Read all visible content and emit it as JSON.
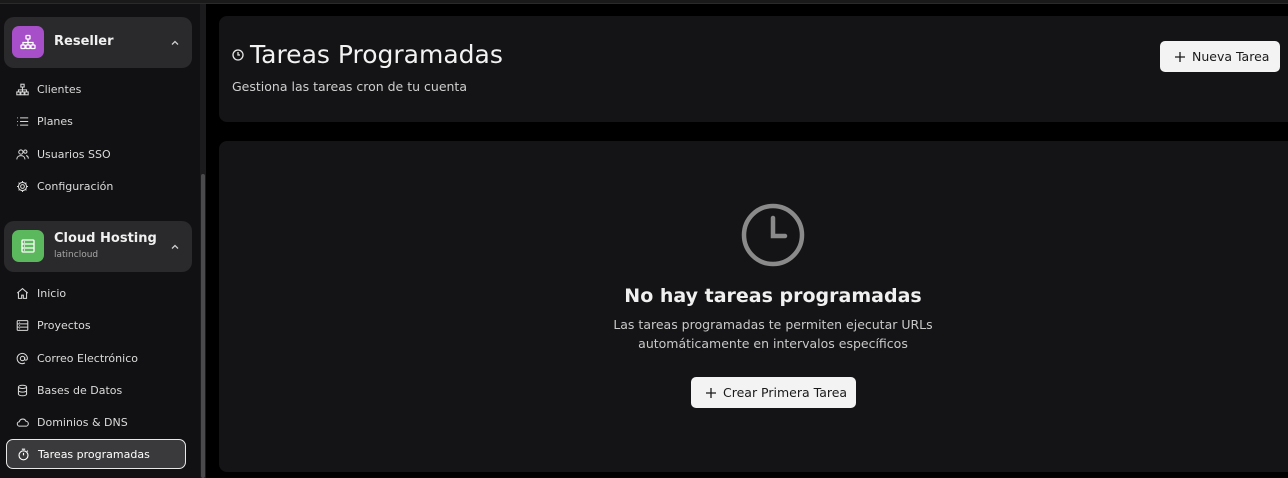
{
  "sidebar": {
    "reseller": {
      "title": "Reseller",
      "icon": "sitemap-icon",
      "color": "#a64fc8",
      "items": [
        {
          "label": "Clientes",
          "icon": "sitemap-icon"
        },
        {
          "label": "Planes",
          "icon": "list-icon"
        },
        {
          "label": "Usuarios SSO",
          "icon": "users-icon"
        },
        {
          "label": "Configuración",
          "icon": "gear-icon"
        }
      ]
    },
    "cloud_hosting": {
      "title": "Cloud Hosting",
      "subtitle": "latincloud",
      "icon": "server-icon",
      "color": "#5cb85c",
      "items": [
        {
          "label": "Inicio",
          "icon": "home-icon"
        },
        {
          "label": "Proyectos",
          "icon": "server-icon"
        },
        {
          "label": "Correo Electrónico",
          "icon": "at-icon"
        },
        {
          "label": "Bases de Datos",
          "icon": "database-icon"
        },
        {
          "label": "Dominios & DNS",
          "icon": "cloud-icon"
        },
        {
          "label": "Tareas programadas",
          "icon": "stopwatch-icon",
          "active": true
        }
      ]
    }
  },
  "header": {
    "title": "Tareas Programadas",
    "subtitle": "Gestiona las tareas cron de tu cuenta",
    "new_task_label": "Nueva Tarea"
  },
  "empty_state": {
    "title": "No hay tareas programadas",
    "description_line1": "Las tareas programadas te permiten ejecutar URLs",
    "description_line2": "automáticamente en intervalos específicos",
    "button_label": "Crear Primera Tarea"
  },
  "colors": {
    "background": "#000000",
    "sidebar": "#111113",
    "card": "#141416",
    "button": "#f3f3f3"
  }
}
